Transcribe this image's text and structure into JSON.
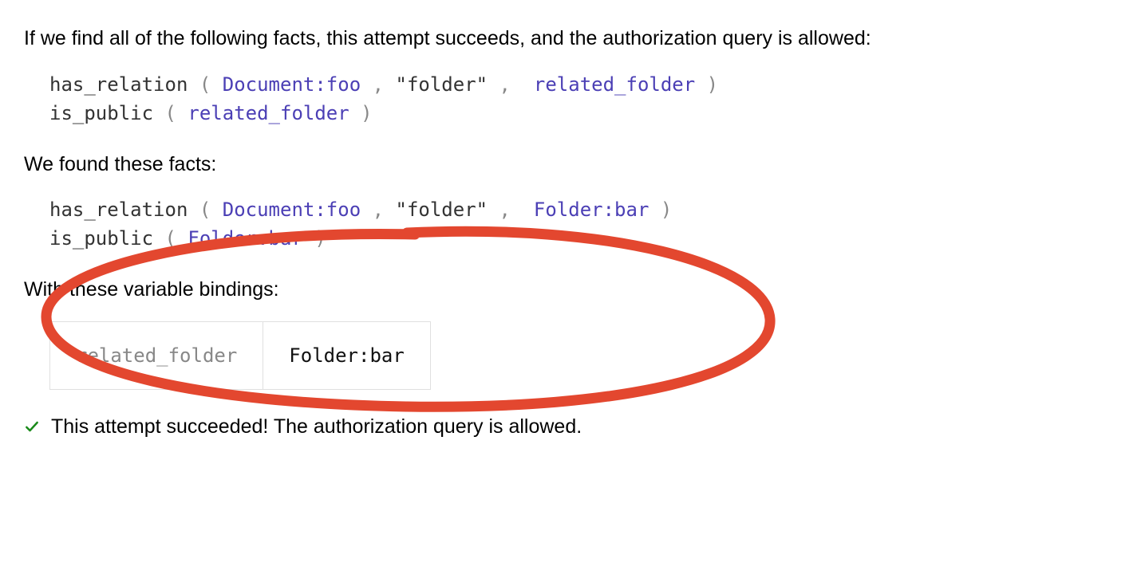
{
  "intro_text": "If we find all of the following facts, this attempt succeeds, and the authorization query is allowed:",
  "facts_needed": [
    {
      "fn": "has_relation",
      "open": "(",
      "a": "Document:foo",
      "c1": ",",
      "b": "\"folder\"",
      "c2": ",",
      "c": "related_folder",
      "close": ")"
    },
    {
      "fn": "is_public",
      "open": "(",
      "a": "related_folder",
      "close": ")"
    }
  ],
  "found_label": "We found these facts:",
  "facts_found": [
    {
      "fn": "has_relation",
      "open": "(",
      "a": "Document:foo",
      "c1": ",",
      "b": "\"folder\"",
      "c2": ",",
      "c": "Folder:bar",
      "close": ")"
    },
    {
      "fn": "is_public",
      "open": "(",
      "a": "Folder:bar",
      "close": ")"
    }
  ],
  "bindings_label": "With these variable bindings:",
  "bindings": [
    {
      "key": "related_folder",
      "val": "Folder:bar"
    }
  ],
  "result_text": "This attempt succeeded! The authorization query is allowed.",
  "annotation": {
    "kind": "ellipse-highlight",
    "stroke": "#e3472f"
  }
}
